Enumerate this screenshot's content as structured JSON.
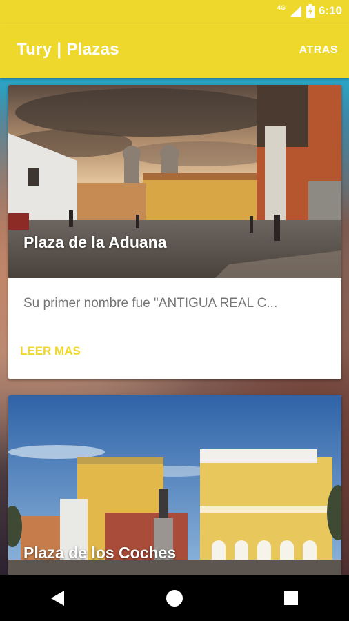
{
  "status_bar": {
    "network": "4G",
    "time": "6:10",
    "icons": [
      "signal-icon",
      "battery-charging-icon"
    ]
  },
  "app_bar": {
    "title": "Tury | Plazas",
    "back_label": "ATRAS"
  },
  "plazas": [
    {
      "title": "Plaza de la Aduana",
      "description": "Su primer nombre fue \"ANTIGUA REAL C...",
      "action_label": "LEER MAS"
    },
    {
      "title": "Plaza de los Coches"
    }
  ],
  "nav_bar": {
    "icons": [
      "back-icon",
      "home-icon",
      "recents-icon"
    ]
  },
  "colors": {
    "accent": "#eed82c",
    "nav_background": "#000000",
    "description_text": "#757575"
  }
}
